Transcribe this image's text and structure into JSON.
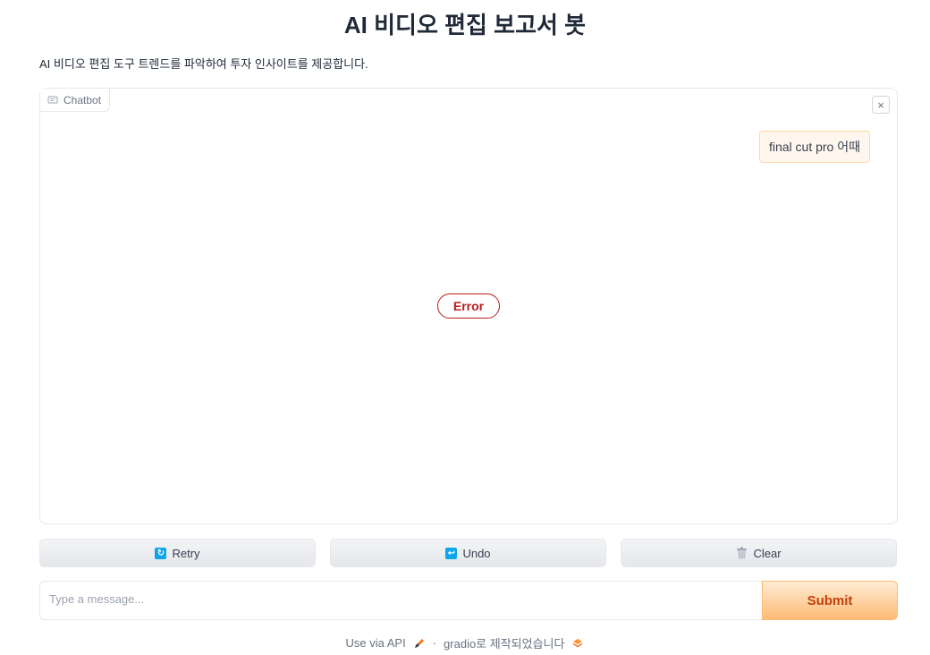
{
  "header": {
    "title": "AI 비디오 편집 보고서 봇",
    "description": "AI 비디오 편집 도구 트렌드를 파악하여 투자 인사이트를 제공합니다."
  },
  "chatbot": {
    "label": "Chatbot",
    "clear_symbol": "×",
    "messages": [
      {
        "role": "user",
        "text": "final cut pro 어때"
      }
    ],
    "error_text": "Error"
  },
  "actions": {
    "retry_label": "Retry",
    "undo_label": "Undo",
    "clear_label": "Clear"
  },
  "input": {
    "placeholder": "Type a message...",
    "value": "",
    "submit_label": "Submit"
  },
  "footer": {
    "api_link": "Use via API",
    "separator": "·",
    "built_with": "gradio로 제작되었습니다"
  },
  "colors": {
    "accent": "#f97316",
    "error": "#b91c1c",
    "icon_blue": "#0ea5e9"
  }
}
